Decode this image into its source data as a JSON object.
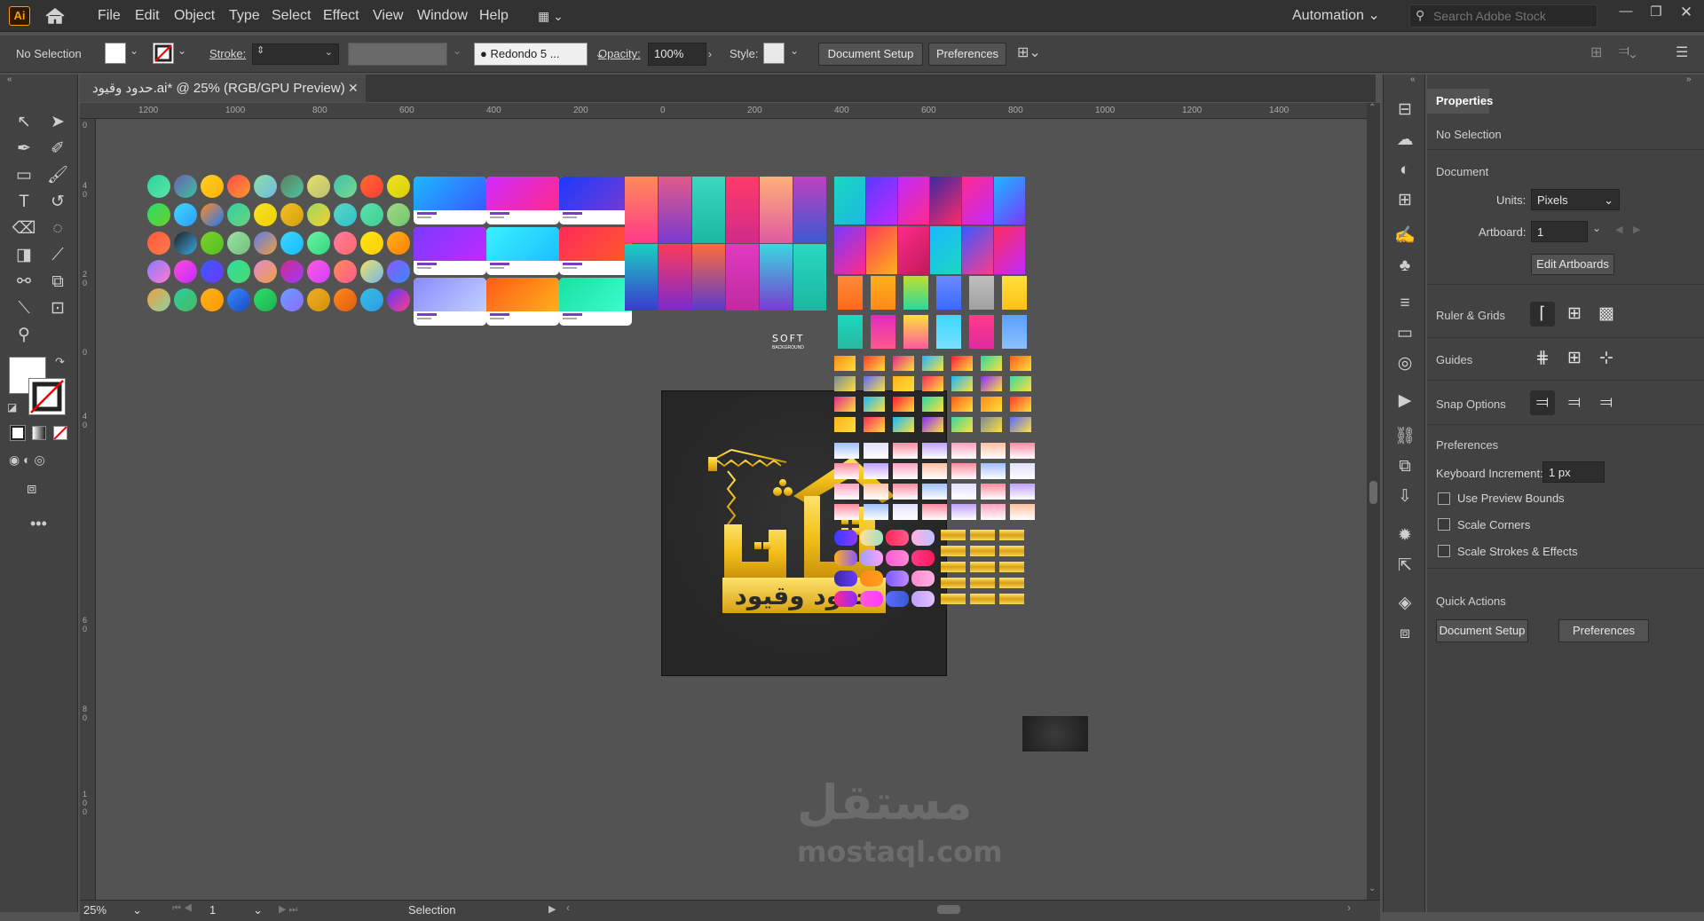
{
  "app": {
    "logo": "Ai"
  },
  "menu": [
    "File",
    "Edit",
    "Object",
    "Type",
    "Select",
    "Effect",
    "View",
    "Window",
    "Help"
  ],
  "workspace": "Automation",
  "search": {
    "placeholder": "Search Adobe Stock"
  },
  "control": {
    "selection": "No Selection",
    "stroke_label": "Stroke:",
    "brush": "Redondo 5 ...",
    "opacity_label": "Opacity:",
    "opacity_value": "100%",
    "style_label": "Style:",
    "document_setup": "Document Setup",
    "preferences": "Preferences"
  },
  "document": {
    "tab_title": "حدود وقيود.ai* @ 25% (RGB/GPU Preview)"
  },
  "ruler_h": [
    "1200",
    "1000",
    "800",
    "600",
    "400",
    "200",
    "0",
    "200",
    "400",
    "600",
    "800",
    "1000",
    "1200",
    "1400"
  ],
  "ruler_v": [
    "0",
    "4 0",
    "2 0",
    "0",
    "4 0",
    "6 0",
    "8 0",
    "1 0 0"
  ],
  "artboard": {
    "brand_top": "ثاقـا",
    "brand_bottom": "حدود وقيود",
    "soft_label": "SOFT",
    "soft_sub": "BACKGROUND"
  },
  "watermark": {
    "arabic": "مستقل",
    "latin": "mostaql.com"
  },
  "status": {
    "zoom": "25%",
    "artboard": "1",
    "tool": "Selection"
  },
  "panel": {
    "title": "Properties",
    "selection": "No Selection",
    "document": "Document",
    "units_label": "Units:",
    "units_value": "Pixels",
    "artboard_label": "Artboard:",
    "artboard_value": "1",
    "edit_artboards": "Edit Artboards",
    "ruler_grids": "Ruler & Grids",
    "guides": "Guides",
    "snap_options": "Snap Options",
    "preferences": "Preferences",
    "keyboard_increment_label": "Keyboard Increment:",
    "keyboard_increment_value": "1 px",
    "use_preview_bounds": "Use Preview Bounds",
    "scale_corners": "Scale Corners",
    "scale_strokes": "Scale Strokes & Effects",
    "quick_actions": "Quick Actions",
    "qa_document_setup": "Document Setup",
    "qa_preferences": "Preferences"
  },
  "colors": {
    "ai_logo_bg": "#2e1a00",
    "ai_logo_fg": "#ff9a00",
    "gold": "#f2c01a",
    "artboard_bg": "#2b2b2b"
  }
}
